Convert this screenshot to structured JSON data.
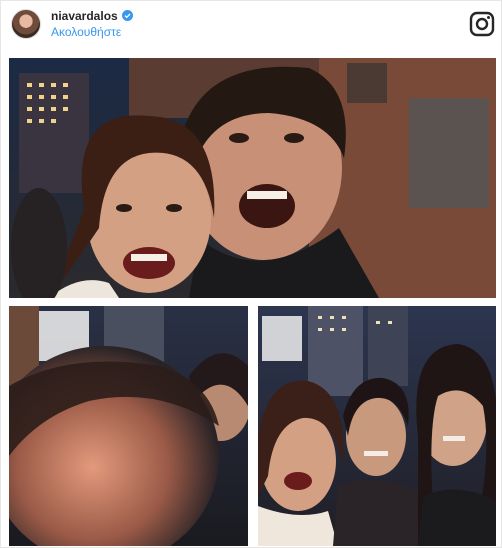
{
  "header": {
    "username": "niavardalos",
    "verified_icon": "verified-badge-icon",
    "follow_label": "Ακολουθήστε",
    "platform_icon": "instagram-icon",
    "accent_color": "#3897f0",
    "verified_color": "#3897f0"
  },
  "photos": [
    {
      "icon": "photo-selfie-couple"
    },
    {
      "icon": "photo-blurred-selfie"
    },
    {
      "icon": "photo-group-selfie"
    }
  ]
}
